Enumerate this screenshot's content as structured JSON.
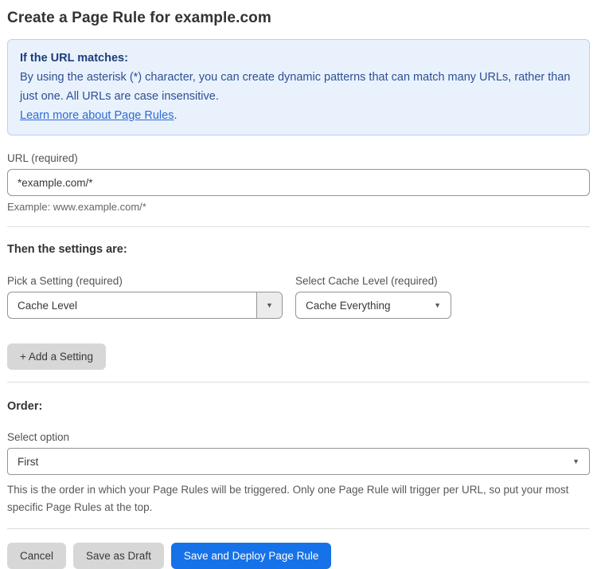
{
  "page": {
    "title": "Create a Page Rule for example.com"
  },
  "info_box": {
    "heading": "If the URL matches:",
    "body": "By using the asterisk (*) character, you can create dynamic patterns that can match many URLs, rather than just one. All URLs are case insensitive.",
    "link_label": "Learn more about Page Rules",
    "link_suffix": "."
  },
  "url_field": {
    "label": "URL (required)",
    "value": "*example.com/*",
    "helper": "Example: www.example.com/*"
  },
  "settings": {
    "heading": "Then the settings are:",
    "setting_picker": {
      "label": "Pick a Setting (required)",
      "value": "Cache Level"
    },
    "cache_level_picker": {
      "label": "Select Cache Level (required)",
      "value": "Cache Everything"
    },
    "add_button_label": "+ Add a Setting"
  },
  "order": {
    "heading": "Order:",
    "select_label": "Select option",
    "value": "First",
    "helper": "This is the order in which your Page Rules will be triggered. Only one Page Rule will trigger per URL, so put your most specific Page Rules at the top."
  },
  "actions": {
    "cancel_label": "Cancel",
    "save_draft_label": "Save as Draft",
    "save_deploy_label": "Save and Deploy Page Rule"
  },
  "icons": {
    "dropdown_caret": "▼"
  },
  "colors": {
    "accent_blue": "#1672e8",
    "info_background": "#e9f2fc",
    "info_border": "#b7d4f1",
    "info_heading_text": "#1c3d7c",
    "info_body_text": "#2e4f96",
    "link_blue": "#2e6ad3",
    "gray_button": "#d7d7d7"
  }
}
